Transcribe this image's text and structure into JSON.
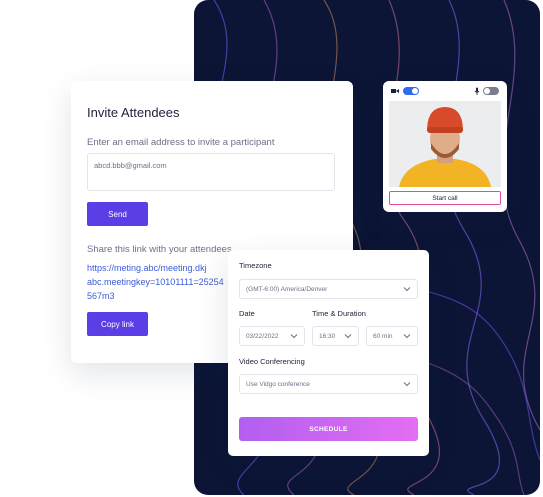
{
  "invite": {
    "title": "Invite Attendees",
    "subtitle": "Enter an email address to invite a participant",
    "email_value": "abcd.bbb@gmail.com",
    "send_label": "Send",
    "share_label": "Share this link with your attendees",
    "link_lines": [
      "https://meting.abc/meeting.dkj",
      "abc.meetingkey=10101111=25254",
      "567m3"
    ],
    "copy_label": "Copy link"
  },
  "video": {
    "camera_on": true,
    "mic_on": false,
    "start_call_label": "Start call"
  },
  "schedule": {
    "timezone_label": "Timezone",
    "timezone_value": "(GMT-6:00) America/Denver",
    "date_label": "Date",
    "date_value": "03/22/2022",
    "time_duration_label": "Time & Duration",
    "time_value": "16:30",
    "duration_value": "60 min",
    "conferencing_label": "Video Conferencing",
    "conferencing_value": "Use Vidgo conference",
    "schedule_label": "SCHEDULE"
  },
  "colors": {
    "background_panel": "#0c1535",
    "primary_button": "#5b3ee6",
    "link": "#3d5bd9",
    "schedule_gradient_start": "#b25ff0",
    "schedule_gradient_end": "#e36ef2",
    "toggle_on": "#2f6bf0"
  }
}
